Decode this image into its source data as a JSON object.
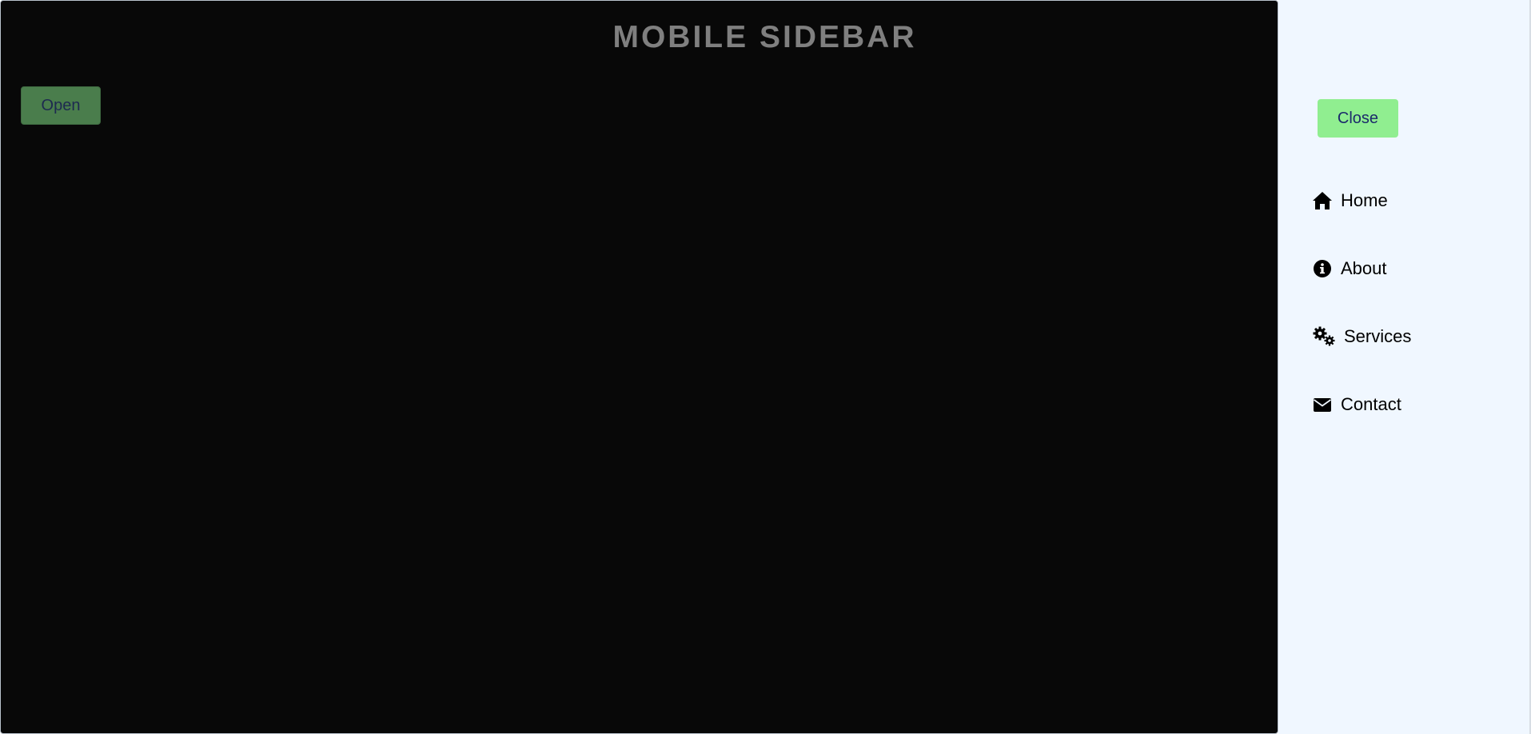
{
  "header": {
    "title": "MOBILE SIDEBAR"
  },
  "main": {
    "open_label": "Open"
  },
  "sidebar": {
    "close_label": "Close",
    "items": [
      {
        "label": "Home",
        "icon": "home-icon"
      },
      {
        "label": "About",
        "icon": "info-circle-icon"
      },
      {
        "label": "Services",
        "icon": "cogs-icon"
      },
      {
        "label": "Contact",
        "icon": "envelope-icon"
      }
    ]
  },
  "colors": {
    "main_background": "#080808",
    "sidebar_background": "#f0f7ff",
    "close_button": "#90ee90",
    "open_button": "#4a7d4c",
    "title_text": "#7f7f7f"
  }
}
